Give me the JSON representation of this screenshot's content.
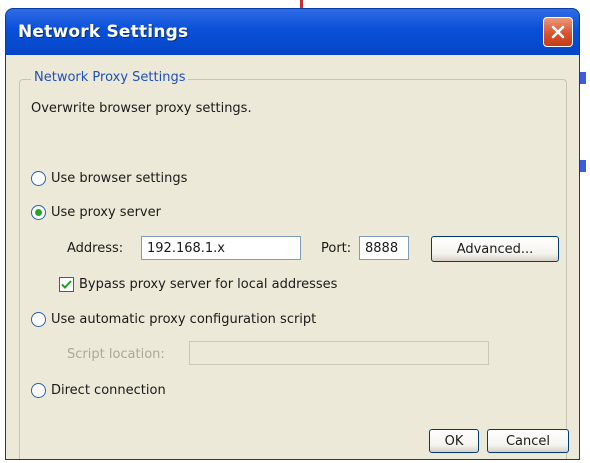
{
  "window": {
    "title": "Network Settings",
    "close_icon": "close-icon",
    "accent": "#0a50d8"
  },
  "group": {
    "legend": "Network Proxy Settings",
    "description": "Overwrite browser proxy settings."
  },
  "options": {
    "browser_settings": {
      "label": "Use browser settings",
      "checked": false
    },
    "proxy_server": {
      "label": "Use proxy server",
      "checked": true
    },
    "automatic_config": {
      "label": "Use automatic proxy configuration script",
      "checked": false
    },
    "direct_connection": {
      "label": "Direct connection",
      "checked": false
    }
  },
  "proxy": {
    "address_label": "Address:",
    "address_value": "192.168.1.x",
    "port_label": "Port:",
    "port_value": "8888",
    "advanced_label": "Advanced...",
    "bypass_label": "Bypass proxy server for local addresses",
    "bypass_checked": true
  },
  "script": {
    "location_label": "Script location:",
    "location_value": ""
  },
  "buttons": {
    "ok_label": "OK",
    "cancel_label": "Cancel"
  }
}
